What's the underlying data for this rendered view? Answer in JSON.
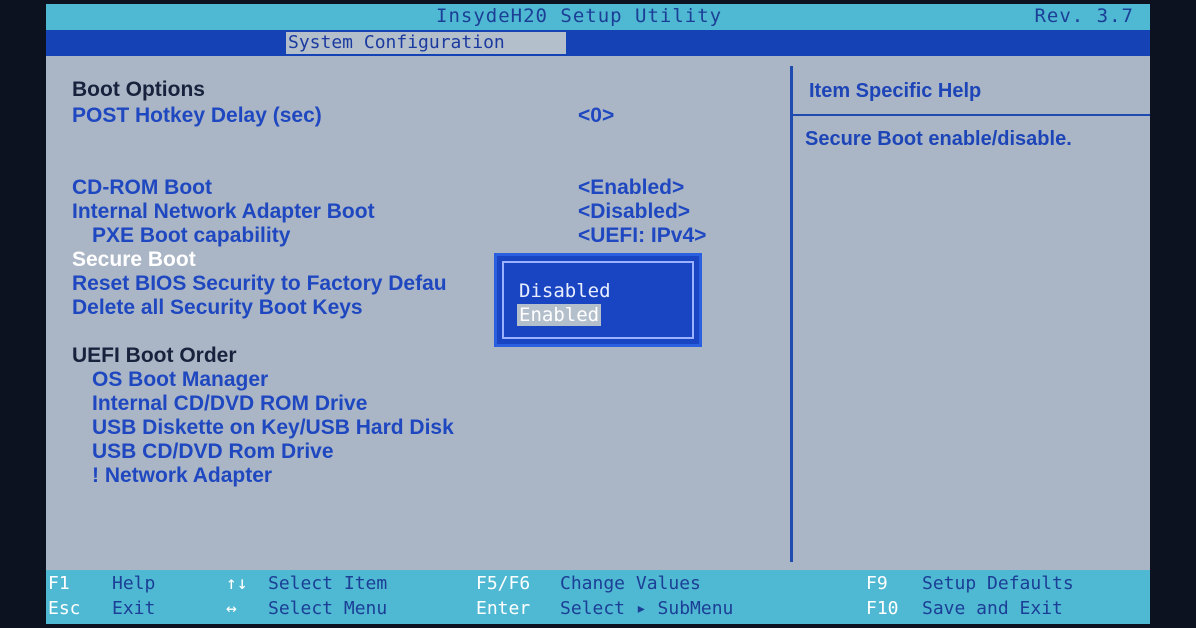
{
  "window": {
    "title": "InsydeH20 Setup Utility",
    "rev": "Rev.  3.7",
    "active_tab": "System Configuration"
  },
  "main": {
    "boot_options_heading": "Boot Options",
    "items": [
      {
        "label": "POST Hotkey Delay (sec)",
        "value": "<0>"
      },
      {
        "label": "CD-ROM Boot",
        "value": "<Enabled>"
      },
      {
        "label": "Internal Network Adapter Boot",
        "value": "<Disabled>"
      },
      {
        "label": "PXE Boot capability",
        "value": "<UEFI: IPv4>"
      },
      {
        "label": "Secure Boot",
        "value": ""
      },
      {
        "label": "Reset BIOS Security to Factory Defau",
        "value": ""
      },
      {
        "label": "Delete all Security Boot Keys",
        "value": ""
      }
    ],
    "uefi_heading": "UEFI Boot Order",
    "boot_order": [
      "OS Boot Manager",
      "Internal CD/DVD ROM Drive",
      "USB Diskette on Key/USB Hard Disk",
      "USB CD/DVD Rom Drive",
      "! Network Adapter"
    ]
  },
  "popup": {
    "options": [
      "Disabled",
      "Enabled"
    ],
    "selected": "Enabled"
  },
  "help": {
    "title": "Item Specific Help",
    "text": "Secure Boot enable/disable."
  },
  "footer": {
    "f1_key": "F1",
    "f1_desc": "Help",
    "arrows_key": "↑↓",
    "arrows_desc": "Select Item",
    "f5f6_key": "F5/F6",
    "f5f6_desc": "Change Values",
    "f9_key": "F9",
    "f9_desc": "Setup Defaults",
    "esc_key": "Esc",
    "esc_desc": "Exit",
    "lr_key": "↔",
    "lr_desc": "Select Menu",
    "enter_key": "Enter",
    "enter_desc": "Select ▸ SubMenu",
    "f10_key": "F10",
    "f10_desc": "Save and Exit"
  },
  "colors": {
    "accent_blue": "#1543b5",
    "footer_cyan": "#4fb8d2",
    "panel_gray": "#aab6c6",
    "highlight_white": "#ffffff"
  }
}
